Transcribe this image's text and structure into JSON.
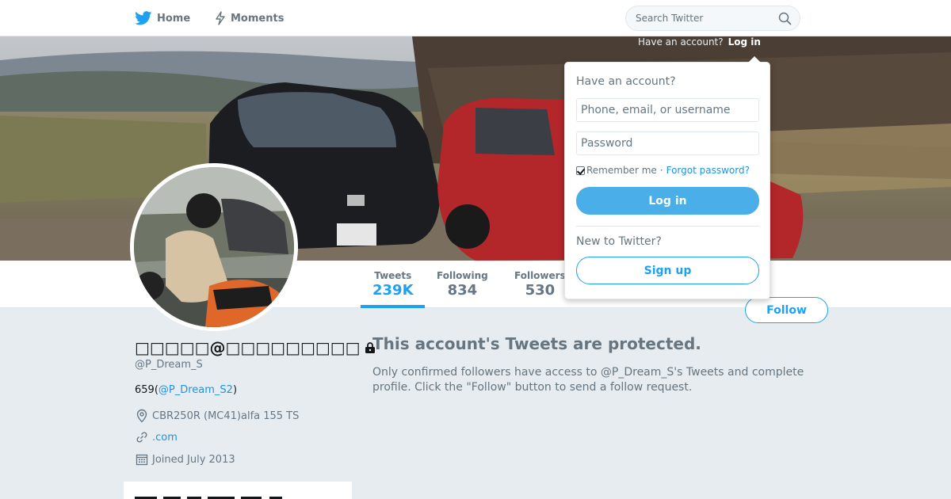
{
  "topnav": {
    "home_label": "Home",
    "moments_label": "Moments",
    "search_placeholder": "Search Twitter"
  },
  "header_login": {
    "prompt": "Have an account?",
    "link": "Log in"
  },
  "login_dropdown": {
    "title": "Have an account?",
    "username_placeholder": "Phone, email, or username",
    "password_placeholder": "Password",
    "remember_label": "Remember me",
    "separator": "·",
    "forgot_label": "Forgot password?",
    "login_button": "Log in",
    "new_prompt": "New to Twitter?",
    "signup_button": "Sign up"
  },
  "stats": [
    {
      "label": "Tweets",
      "value": "239K",
      "active": true
    },
    {
      "label": "Following",
      "value": "834",
      "active": false
    },
    {
      "label": "Followers",
      "value": "530",
      "active": false
    }
  ],
  "follow_button": "Follow",
  "profile": {
    "display_name": "□□□□□@□□□□□□□□□",
    "screen_name": "@P_Dream_S",
    "bio_prefix": "659(",
    "bio_mention": "@P_Dream_S2",
    "bio_suffix": ")",
    "location": "CBR250R (MC41)alfa 155 TS",
    "url": ".com",
    "joined": "Joined July 2013"
  },
  "protected": {
    "title": "This account's Tweets are protected.",
    "description": "Only confirmed followers have access to @P_Dream_S's Tweets and complete profile. Click the \"Follow\" button to send a follow request."
  },
  "colors": {
    "accent": "#1da1f2",
    "background": "#e6ecf0",
    "muted_text": "#657786"
  },
  "icons": {
    "home": "twitter-bird-icon",
    "moments": "lightning-icon",
    "search": "search-icon",
    "lock": "lock-icon",
    "location": "location-pin-icon",
    "url": "link-icon",
    "joined": "calendar-icon"
  }
}
